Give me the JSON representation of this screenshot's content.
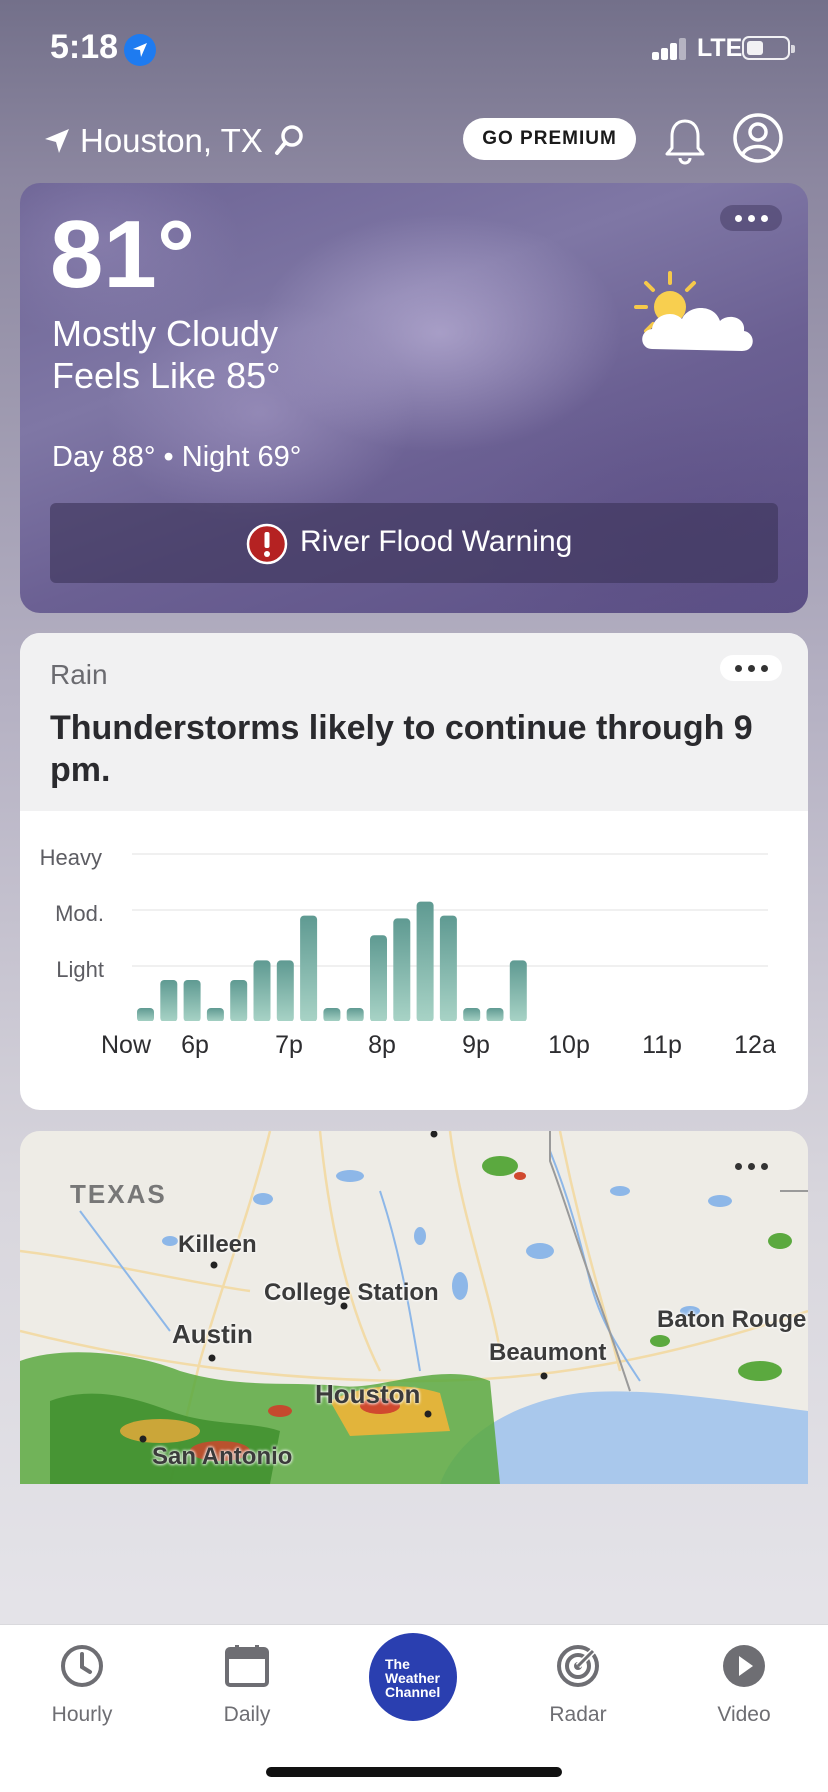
{
  "status_bar": {
    "time": "5:18",
    "network": "LTE"
  },
  "header": {
    "location": "Houston, TX",
    "premium_label": "GO PREMIUM"
  },
  "current": {
    "temperature": "81°",
    "condition": "Mostly Cloudy",
    "feels_like": "Feels Like 85°",
    "day_night": "Day 88° • Night 69°",
    "alert": "River Flood Warning",
    "icon": "partly-cloudy-day-icon"
  },
  "rain": {
    "label": "Rain",
    "headline": "Thunderstorms likely to continue through 9 pm.",
    "chart_data": {
      "type": "bar",
      "y_levels": [
        "Heavy",
        "Mod.",
        "Light"
      ],
      "x_tick_labels": [
        "Now",
        "6p",
        "7p",
        "8p",
        "9p",
        "10p",
        "11p",
        "12a"
      ],
      "values": [
        0.25,
        0.75,
        0.75,
        0.25,
        0.75,
        1.1,
        1.1,
        1.9,
        0.25,
        0.25,
        1.55,
        1.85,
        2.15,
        1.9,
        0.25,
        0.25,
        1.1
      ],
      "ylim": [
        0,
        3
      ],
      "bar_color": "#7fb3a9"
    }
  },
  "map": {
    "state_label": "TEXAS",
    "cities": [
      "Killeen",
      "College Station",
      "Austin",
      "Beaumont",
      "Baton Rouge",
      "Houston",
      "San Antonio"
    ]
  },
  "tabs": [
    {
      "label": "Hourly",
      "icon": "clock-icon"
    },
    {
      "label": "Daily",
      "icon": "calendar-icon"
    },
    {
      "label": "Radar",
      "icon": "radar-icon"
    },
    {
      "label": "Video",
      "icon": "play-icon"
    }
  ],
  "brand": {
    "line1": "The",
    "line2": "Weather",
    "line3": "Channel",
    "color": "#2a3fb0"
  }
}
